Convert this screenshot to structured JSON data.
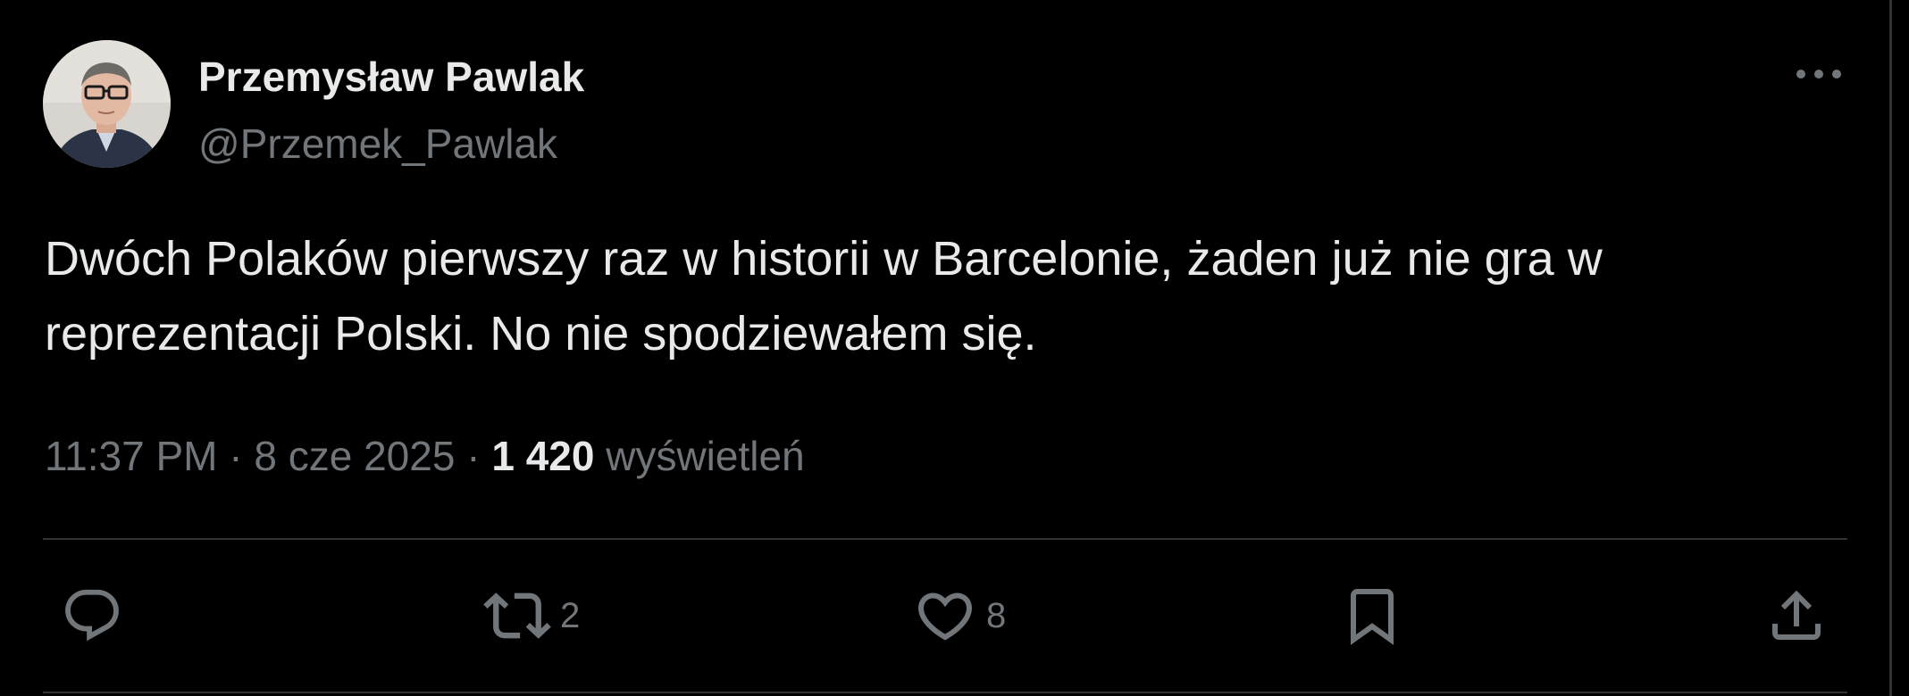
{
  "author": {
    "display_name": "Przemysław Pawlak",
    "handle": "@Przemek_Pawlak",
    "avatar_icon": "avatar-photo"
  },
  "tweet": {
    "text_lines": [
      "Dwóch Polaków pierwszy raz w historii w Barcelonie, żaden już nie gra w",
      "reprezentacji Polski. No nie spodziewałem się."
    ]
  },
  "meta": {
    "time": "11:37 PM",
    "separator": "·",
    "date": "8 cze 2025",
    "views_count": "1 420",
    "views_label": "wyświetleń"
  },
  "actions": {
    "reply": {
      "icon": "reply-icon",
      "count": ""
    },
    "retweet": {
      "icon": "retweet-icon",
      "count": "2"
    },
    "like": {
      "icon": "heart-icon",
      "count": "8"
    },
    "bookmark": {
      "icon": "bookmark-icon",
      "count": ""
    },
    "share": {
      "icon": "share-icon",
      "count": ""
    }
  },
  "more_menu_icon": "more-horizontal-icon",
  "colors": {
    "background": "#000000",
    "primary_text": "#e7e9ea",
    "secondary_text": "#71767b",
    "divider": "#2f3336"
  }
}
